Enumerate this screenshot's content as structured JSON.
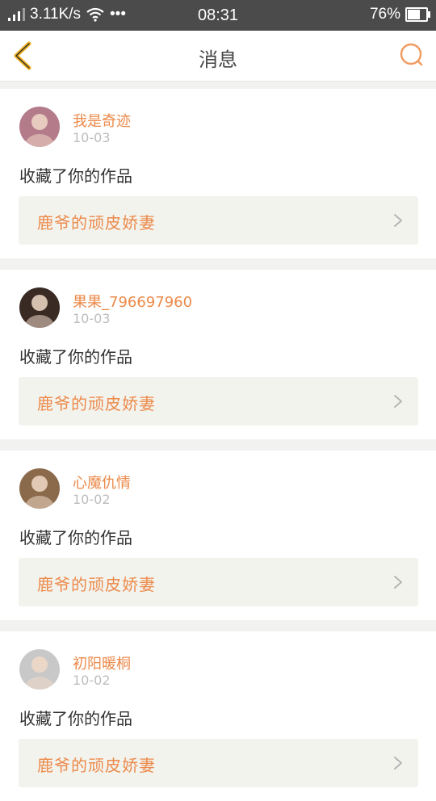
{
  "status_bar": {
    "speed": "3.11K/s",
    "dots": "•••",
    "time": "08:31",
    "battery_percent": "76%",
    "battery_level": 0.76
  },
  "header": {
    "title": "消息"
  },
  "messages": [
    {
      "username": "我是奇迹",
      "date": "10-03",
      "action": "收藏了你的作品",
      "work_title": "鹿爷的顽皮娇妻",
      "avatar_color": "#b47b8a"
    },
    {
      "username": "果果_796697960",
      "date": "10-03",
      "action": "收藏了你的作品",
      "work_title": "鹿爷的顽皮娇妻",
      "avatar_color": "#3a2a24"
    },
    {
      "username": "心魔仇情",
      "date": "10-02",
      "action": "收藏了你的作品",
      "work_title": "鹿爷的顽皮娇妻",
      "avatar_color": "#8a6a4a"
    },
    {
      "username": "初阳暖桐",
      "date": "10-02",
      "action": "收藏了你的作品",
      "work_title": "鹿爷的顽皮娇妻",
      "avatar_color": "#c8c8c8"
    }
  ],
  "colors": {
    "accent": "#ec8a4a",
    "back_arrow": "#f0b020",
    "status_bar": "#4b4b4b"
  }
}
